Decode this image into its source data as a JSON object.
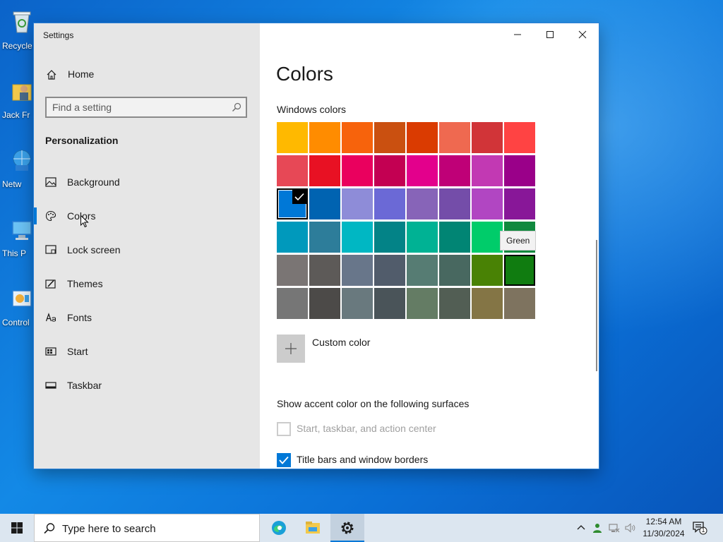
{
  "desktop": {
    "icons": [
      {
        "label": "Recycle"
      },
      {
        "label": "Jack Fr"
      },
      {
        "label": "Netw"
      },
      {
        "label": "This P"
      },
      {
        "label": "Control"
      }
    ]
  },
  "window": {
    "title": "Settings",
    "controls": {
      "minimize": "minimize",
      "maximize": "maximize",
      "close": "close"
    }
  },
  "sidebar": {
    "home_label": "Home",
    "search_placeholder": "Find a setting",
    "section_title": "Personalization",
    "items": [
      {
        "label": "Background",
        "icon": "picture-icon"
      },
      {
        "label": "Colors",
        "icon": "palette-icon",
        "active": true
      },
      {
        "label": "Lock screen",
        "icon": "lock-screen-icon"
      },
      {
        "label": "Themes",
        "icon": "brush-icon"
      },
      {
        "label": "Fonts",
        "icon": "font-icon"
      },
      {
        "label": "Start",
        "icon": "start-icon"
      },
      {
        "label": "Taskbar",
        "icon": "taskbar-icon"
      }
    ]
  },
  "content": {
    "title": "Colors",
    "windows_colors_label": "Windows colors",
    "swatches": [
      [
        "#FFB900",
        "#FF8C00",
        "#F7630C",
        "#CA5010",
        "#DA3B01",
        "#EF6950",
        "#D13438",
        "#FF4343"
      ],
      [
        "#E74856",
        "#E81123",
        "#EA005E",
        "#C30052",
        "#E3008C",
        "#BF0077",
        "#C239B3",
        "#9A0089"
      ],
      [
        "#0078D7",
        "#0063B1",
        "#8E8CD8",
        "#6B69D6",
        "#8764B8",
        "#744DA9",
        "#B146C2",
        "#881798"
      ],
      [
        "#0099BC",
        "#2D7D9A",
        "#00B7C3",
        "#038387",
        "#00B294",
        "#018574",
        "#00CC6A",
        "#10893E"
      ],
      [
        "#7A7574",
        "#5D5A58",
        "#68768A",
        "#515C6B",
        "#567C73",
        "#486860",
        "#498205",
        "#107C10"
      ],
      [
        "#767676",
        "#4C4A48",
        "#69797E",
        "#4A5459",
        "#647C64",
        "#525E54",
        "#847545",
        "#7E735F"
      ]
    ],
    "selected": {
      "row": 2,
      "col": 0
    },
    "hovered": {
      "row": 4,
      "col": 7
    },
    "tooltip": "Green",
    "custom_color_label": "Custom color",
    "surfaces_heading": "Show accent color on the following surfaces",
    "checkboxes": [
      {
        "label": "Start, taskbar, and action center",
        "checked": false,
        "disabled": true
      },
      {
        "label": "Title bars and window borders",
        "checked": true,
        "disabled": false
      }
    ],
    "colors": {
      "accent": "#0078D7",
      "disabled_text": "#A0A0A0"
    }
  },
  "taskbar": {
    "search_placeholder": "Type here to search",
    "apps": [
      "edge-icon",
      "file-explorer-icon",
      "settings-icon"
    ],
    "tray": [
      "chevron-up-icon",
      "people-icon",
      "network-icon",
      "volume-icon"
    ],
    "time": "12:54 AM",
    "date": "11/30/2024",
    "notification_count": "1"
  }
}
